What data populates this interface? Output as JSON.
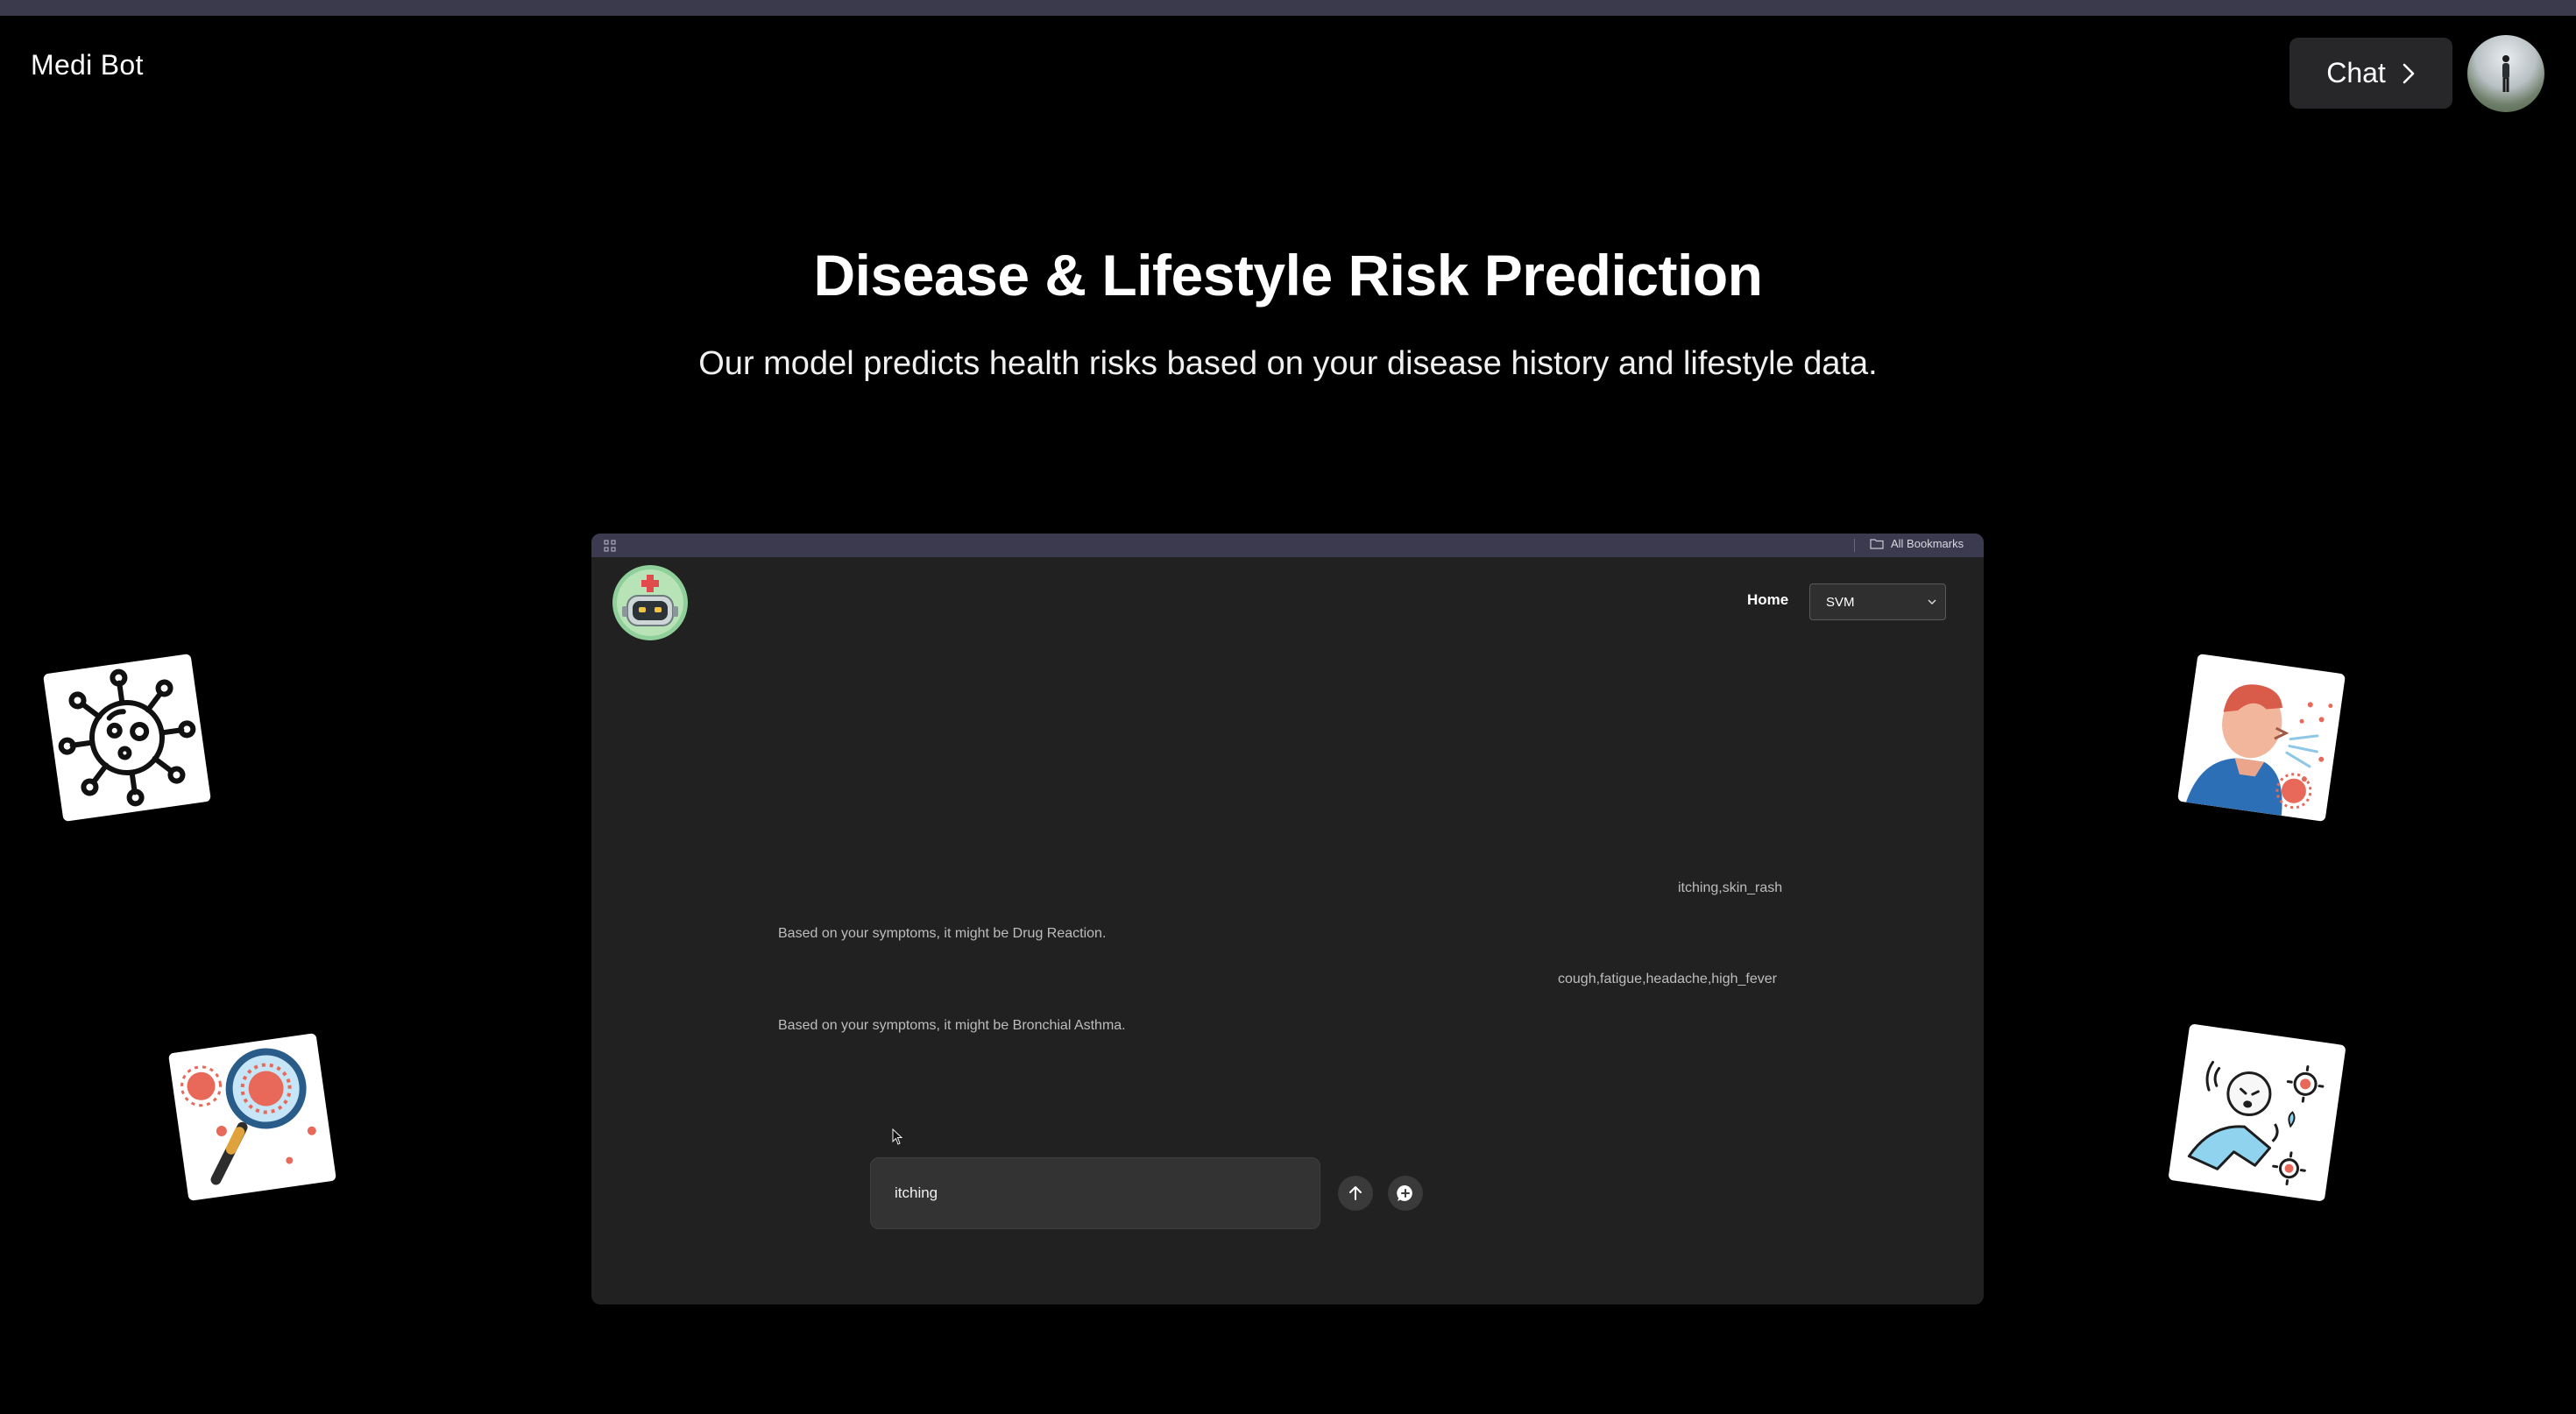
{
  "app": {
    "brand": "Medi Bot",
    "chat_button_label": "Chat"
  },
  "hero": {
    "title": "Disease & Lifestyle Risk Prediction",
    "subtitle": "Our model predicts health risks based on your disease history and lifestyle data."
  },
  "preview": {
    "bookmarks_label": "All Bookmarks",
    "nav_home": "Home",
    "model_select": {
      "selected": "SVM"
    },
    "messages": [
      {
        "role": "user",
        "text": "itching,skin_rash"
      },
      {
        "role": "bot",
        "text": "Based on your symptoms, it might be Drug Reaction."
      },
      {
        "role": "user",
        "text": "cough,fatigue,headache,high_fever"
      },
      {
        "role": "bot",
        "text": "Based on your symptoms, it might be Bronchial Asthma."
      }
    ],
    "input_value": "itching"
  },
  "colors": {
    "background": "#000000",
    "top_strip": "#3b3a4c",
    "frame_background": "#212121",
    "chat_button": "#27272a",
    "virus_red": "#e8695a"
  },
  "icons": {
    "chat_chevron": "chevron-right-icon",
    "send": "arrow-up-icon",
    "chat_plus": "chat-plus-icon",
    "apps": "apps-grid-icon",
    "folder": "folder-icon",
    "select_caret": "chevron-down-icon"
  }
}
